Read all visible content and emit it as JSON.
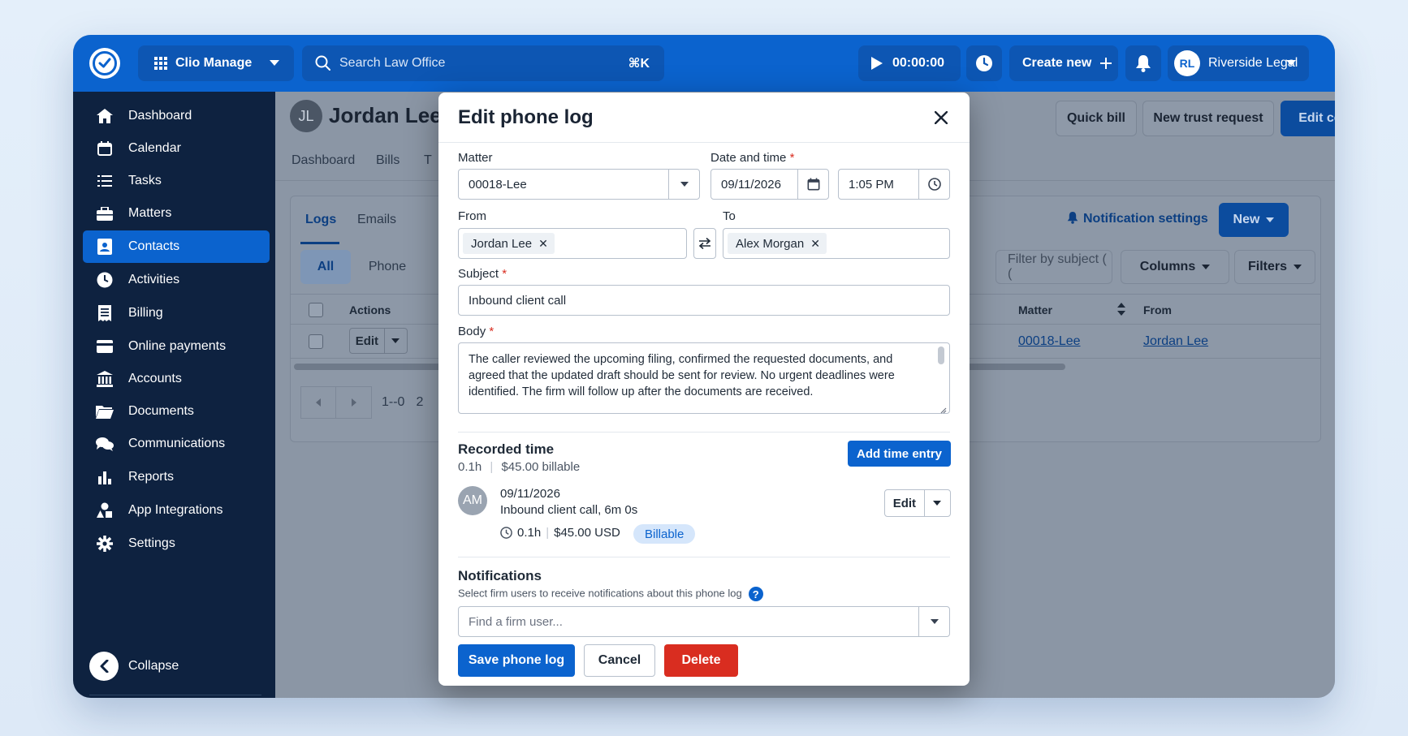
{
  "topbar": {
    "app_name": "Clio Manage",
    "search_placeholder": "Search Law Office",
    "search_shortcut": "⌘K",
    "timer": "00:00:00",
    "create_new": "Create new",
    "user_initials": "RL",
    "user_name": "Riverside Legal"
  },
  "sidebar": {
    "items": [
      {
        "label": "Dashboard"
      },
      {
        "label": "Calendar"
      },
      {
        "label": "Tasks"
      },
      {
        "label": "Matters"
      },
      {
        "label": "Contacts"
      },
      {
        "label": "Activities"
      },
      {
        "label": "Billing"
      },
      {
        "label": "Online payments"
      },
      {
        "label": "Accounts"
      },
      {
        "label": "Documents"
      },
      {
        "label": "Communications"
      },
      {
        "label": "Reports"
      },
      {
        "label": "App Integrations"
      },
      {
        "label": "Settings"
      }
    ],
    "active": "Contacts",
    "collapse": "Collapse"
  },
  "contact": {
    "initials": "JL",
    "name": "Jordan Lee",
    "quick_bill": "Quick bill",
    "new_trust": "New trust request",
    "edit_contact": "Edit contact",
    "tabs": [
      "Dashboard",
      "Bills",
      "T"
    ],
    "subtabs": [
      "Logs",
      "Emails"
    ],
    "notif_settings": "Notification settings",
    "new_btn": "New",
    "pills": [
      "All",
      "Phone"
    ],
    "filter_placeholder": "Filter by subject ( (",
    "columns": "Columns",
    "filters": "Filters",
    "table": {
      "col_actions": "Actions",
      "col_matter": "Matter",
      "col_from": "From",
      "row_edit": "Edit",
      "row_matter": "00018-Lee",
      "row_from": "Jordan Lee"
    },
    "pager_text": "1--0",
    "pager_next": "2"
  },
  "modal": {
    "title": "Edit phone log",
    "matter_label": "Matter",
    "matter_value": "00018-Lee",
    "date_label": "Date and time",
    "date_value": "09/11/2026",
    "time_value": "1:05 PM",
    "from_label": "From",
    "from_value": "Jordan Lee",
    "to_label": "To",
    "to_value": "Alex Morgan",
    "subject_label": "Subject",
    "subject_value": "Inbound client call",
    "body_label": "Body",
    "body_value": "The caller reviewed the upcoming filing, confirmed the requested documents, and agreed that the updated draft should be sent for review. No urgent deadlines were identified. The firm will follow up after the documents are received.",
    "recorded_title": "Recorded time",
    "recorded_hours": "0.1h",
    "recorded_billable": "$45.00 billable",
    "add_time_entry": "Add time entry",
    "entry": {
      "initials": "AM",
      "date": "09/11/2026",
      "description": "Inbound client call, 6m 0s",
      "hours": "0.1h",
      "amount": "$45.00 USD",
      "badge": "Billable",
      "edit": "Edit"
    },
    "notifications_title": "Notifications",
    "notifications_desc": "Select firm users to receive notifications about this phone log",
    "firm_user_placeholder": "Find a firm user...",
    "save": "Save phone log",
    "cancel": "Cancel",
    "delete": "Delete"
  },
  "colors": {
    "brand": "#0b63ce",
    "sidebar": "#0e2240",
    "danger": "#d92d20"
  }
}
